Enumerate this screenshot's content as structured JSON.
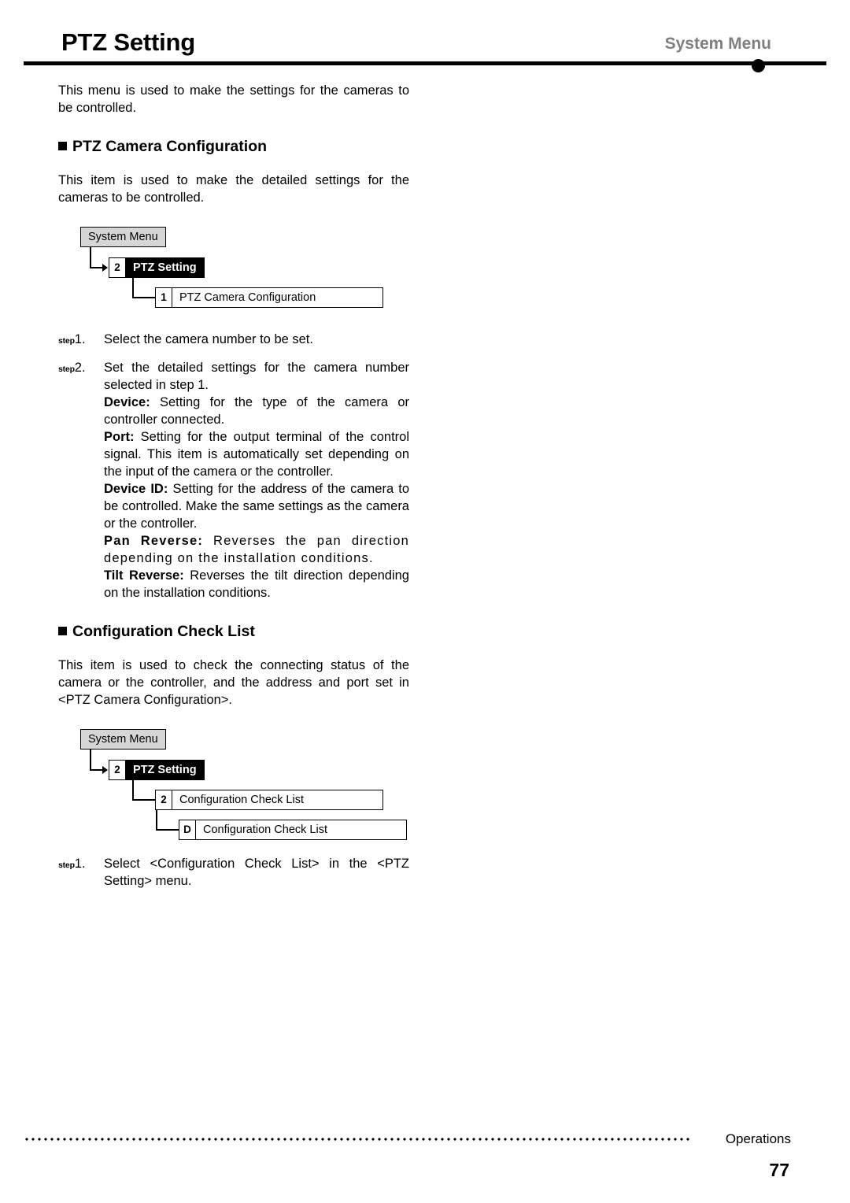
{
  "header": {
    "title": "PTZ Setting",
    "section": "System Menu"
  },
  "intro": "This menu is used to make the settings for the cameras to be controlled.",
  "sections": [
    {
      "heading": "PTZ Camera Configuration",
      "body": "This item is used to make the detailed settings for the cameras to be controlled.",
      "flow": {
        "root": "System Menu",
        "level2_key": "2",
        "level2_label": "PTZ Setting",
        "level3_key": "1",
        "level3_label": "PTZ Camera Configuration"
      },
      "steps": [
        {
          "prefix": "step",
          "number": "1.",
          "text": "Select the camera number to be set."
        },
        {
          "prefix": "step",
          "number": "2.",
          "text": "Set the detailed settings for the camera number selected in step 1."
        }
      ],
      "details": [
        {
          "term": "Device:",
          "text": " Setting for the type of the camera or controller connected."
        },
        {
          "term": "Port:",
          "text": " Setting for the output terminal of the control signal. This item is automatically set depending on the input of the camera or the controller."
        },
        {
          "term": "Device ID:",
          "text": " Setting for the address of the camera to be controlled. Make the same settings as the camera or the controller."
        },
        {
          "term": "Pan Reverse:",
          "text": " Reverses the pan direction depending on the installation conditions."
        },
        {
          "term": "Tilt Reverse:",
          "text": " Reverses the tilt direction depending on the installation conditions."
        }
      ]
    },
    {
      "heading": "Configuration Check List",
      "body": "This item is used to check the connecting status of the camera or the controller, and the address and port set in <PTZ Camera Configuration>.",
      "flow": {
        "root": "System Menu",
        "level2_key": "2",
        "level2_label": "PTZ Setting",
        "level3_key": "2",
        "level3_label": "Configuration Check List",
        "level4_key": "D",
        "level4_label": "Configuration Check List"
      },
      "steps": [
        {
          "prefix": "step",
          "number": "1.",
          "text": "Select <Configuration Check List> in the <PTZ Setting> menu."
        }
      ]
    }
  ],
  "footer": {
    "label": "Operations",
    "page": "77"
  }
}
